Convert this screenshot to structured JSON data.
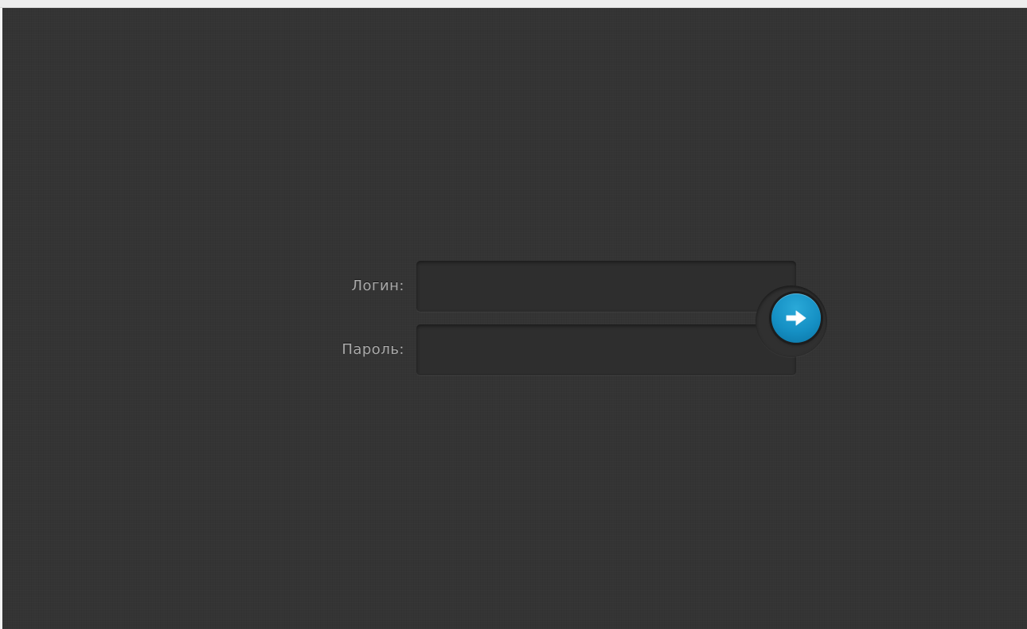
{
  "login_form": {
    "login_label": "Логин:",
    "login_value": "",
    "password_label": "Пароль:",
    "password_value": "",
    "submit_icon": "arrow-right-icon"
  },
  "colors": {
    "background": "#343434",
    "field_background": "#2e2e2e",
    "label_text": "#a9a9a9",
    "button_accent": "#1590c4"
  }
}
